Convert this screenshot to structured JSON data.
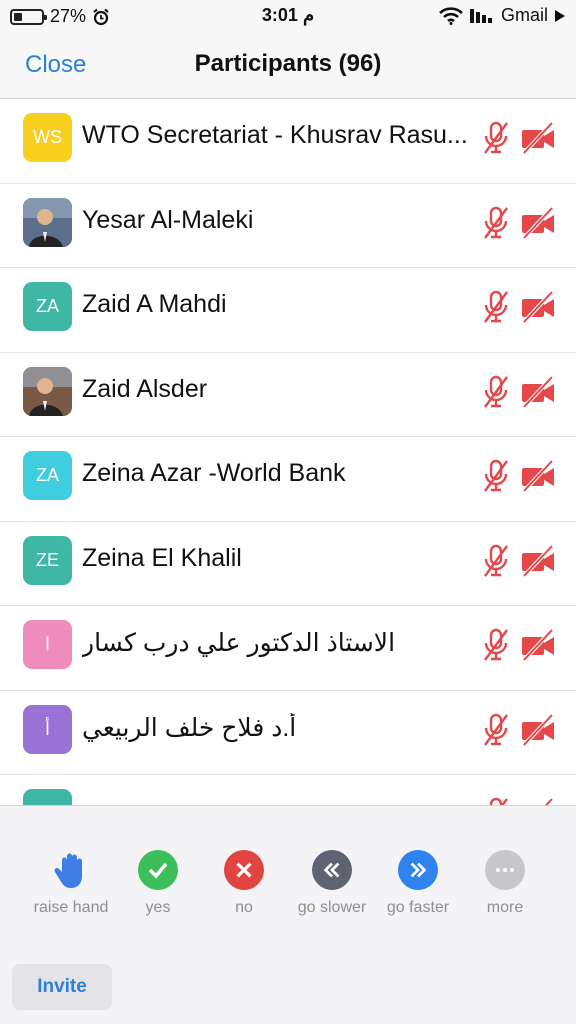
{
  "status_bar": {
    "battery": "27%",
    "time": "3:01 م",
    "carrier": "Gmail"
  },
  "header": {
    "close_label": "Close",
    "title": "Participants (96)"
  },
  "participants": [
    {
      "name": "WTO Secretariat - Khusrav Rasu...",
      "initials": "WS",
      "avatar_color": "#f7cf1c",
      "photo": false,
      "mic": "muted",
      "video": "off"
    },
    {
      "name": "Yesar Al-Maleki",
      "initials": "",
      "avatar_color": "#5b6f8a",
      "photo": true,
      "mic": "muted",
      "video": "off"
    },
    {
      "name": "Zaid A Mahdi",
      "initials": "ZA",
      "avatar_color": "#3fb7a4",
      "photo": false,
      "mic": "muted",
      "video": "off"
    },
    {
      "name": "Zaid Alsder",
      "initials": "",
      "avatar_color": "#7a5a44",
      "photo": true,
      "mic": "muted",
      "video": "off"
    },
    {
      "name": "Zeina Azar -World Bank",
      "initials": "ZA",
      "avatar_color": "#40cde0",
      "photo": false,
      "mic": "muted",
      "video": "off"
    },
    {
      "name": "Zeina El Khalil",
      "initials": "ZE",
      "avatar_color": "#3fb7a4",
      "photo": false,
      "mic": "muted",
      "video": "off"
    },
    {
      "name": "الاستاذ الدكتور علي درب كسار",
      "initials": "ا",
      "avatar_color": "#ee8cbb",
      "photo": false,
      "mic": "muted",
      "video": "off",
      "rtl": true
    },
    {
      "name": "أ.د فلاح خلف الربيعي",
      "initials": "أ",
      "avatar_color": "#9a72d6",
      "photo": false,
      "mic": "muted",
      "video": "off",
      "rtl": true
    },
    {
      "name": "",
      "initials": "",
      "avatar_color": "#3fb7a4",
      "photo": false,
      "mic": "muted",
      "video": "off",
      "rtl": true
    }
  ],
  "reactions": [
    {
      "label": "raise hand",
      "icon": "raise-hand-icon",
      "color": "#3d7fe6"
    },
    {
      "label": "yes",
      "icon": "checkmark-icon",
      "color": "#3cbe5a"
    },
    {
      "label": "no",
      "icon": "x-icon",
      "color": "#e2453f"
    },
    {
      "label": "go slower",
      "icon": "rewind-icon",
      "color": "#5f6270"
    },
    {
      "label": "go faster",
      "icon": "fast-forward-icon",
      "color": "#2f83ee"
    },
    {
      "label": "more",
      "icon": "more-icon",
      "color": "#c7c7cc"
    }
  ],
  "invite_label": "Invite",
  "colors": {
    "accent": "#2b7fd8",
    "muted_red": "#e5474b"
  }
}
